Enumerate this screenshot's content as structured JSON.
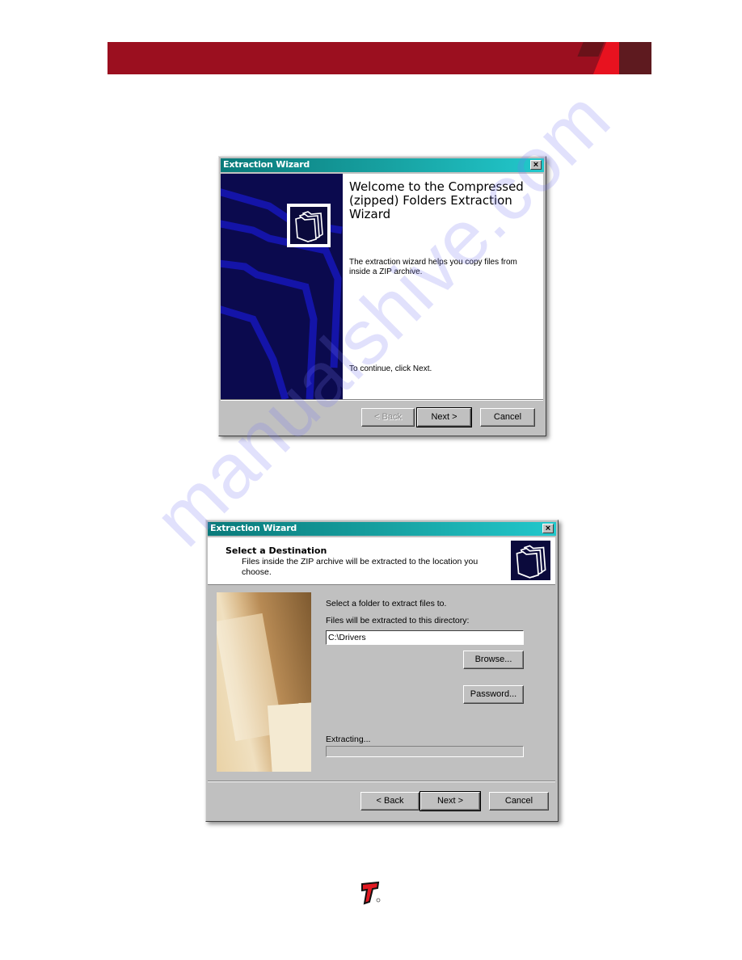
{
  "banner": {
    "accent_color": "#9b0f1f",
    "highlight_color": "#e8121f"
  },
  "dialog1": {
    "title": "Extraction Wizard",
    "close_icon": "close-icon",
    "heading": "Welcome to the Compressed (zipped) Folders Extraction Wizard",
    "description": "The extraction wizard helps you copy files from inside a ZIP archive.",
    "continue_text": "To continue, click Next.",
    "buttons": {
      "back": "< Back",
      "next": "Next >",
      "cancel": "Cancel"
    },
    "back_disabled": true
  },
  "dialog2": {
    "title": "Extraction Wizard",
    "header_title": "Select a Destination",
    "header_subtitle": "Files inside the ZIP archive will be extracted to the location you choose.",
    "select_label": "Select a folder to extract files to.",
    "directory_label": "Files will be extracted to this directory:",
    "directory_value": "C:\\Drivers",
    "browse_label": "Browse...",
    "password_label": "Password...",
    "progress_label": "Extracting...",
    "progress_percent": 0,
    "buttons": {
      "back": "< Back",
      "next": "Next >",
      "cancel": "Cancel"
    }
  },
  "watermark": "manualshive.com",
  "footer": {
    "logo": "brand-logo-icon"
  }
}
